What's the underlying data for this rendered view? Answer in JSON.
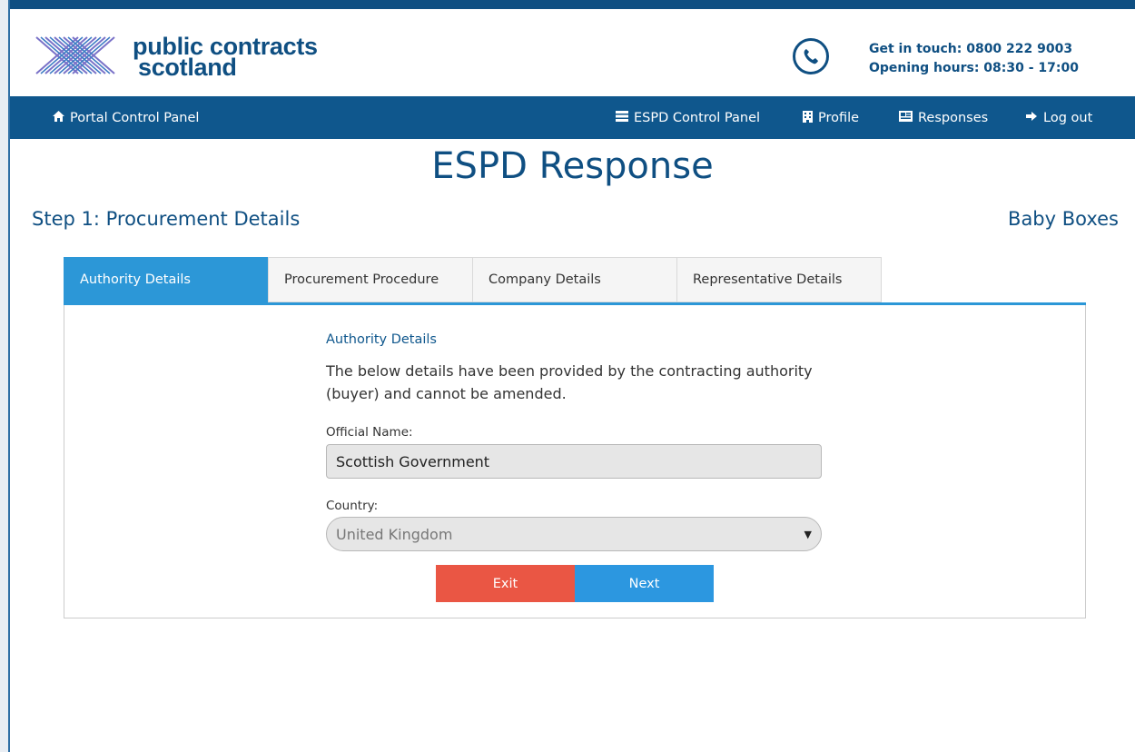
{
  "brand": {
    "line1": "public contracts",
    "line2": "scotland"
  },
  "contact": {
    "phone": "Get in touch: 0800 222 9003",
    "hours": "Opening hours: 08:30 - 17:00"
  },
  "nav": {
    "portal": "Portal Control Panel",
    "espd": "ESPD Control Panel",
    "profile": "Profile",
    "responses": "Responses",
    "logout": "Log out"
  },
  "page": {
    "title": "ESPD Response",
    "step": "Step 1: Procurement Details",
    "project": "Baby Boxes"
  },
  "tabs": [
    {
      "label": "Authority Details",
      "active": true
    },
    {
      "label": "Procurement Procedure",
      "active": false
    },
    {
      "label": "Company Details",
      "active": false
    },
    {
      "label": "Representative Details",
      "active": false
    }
  ],
  "form": {
    "section_title": "Authority Details",
    "info": "The below details have been provided by the contracting authority (buyer) and cannot be amended.",
    "official_name_label": "Official Name:",
    "official_name_value": "Scottish Government",
    "country_label": "Country:",
    "country_value": "United Kingdom"
  },
  "buttons": {
    "exit": "Exit",
    "next": "Next"
  },
  "colors": {
    "brand_blue": "#0f4f82",
    "nav_blue": "#0f578d",
    "active_tab": "#2c97d7",
    "exit_red": "#ea5644",
    "next_blue": "#2c97e0"
  }
}
